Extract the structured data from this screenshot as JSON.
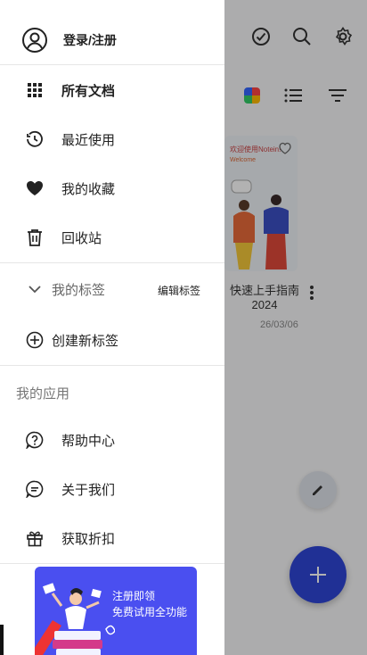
{
  "drawer": {
    "login": "登录/注册",
    "items": [
      {
        "label": "所有文档",
        "icon": "grid-icon"
      },
      {
        "label": "最近使用",
        "icon": "clock-icon"
      },
      {
        "label": "我的收藏",
        "icon": "heart-icon"
      },
      {
        "label": "回收站",
        "icon": "trash-icon"
      }
    ],
    "tags": {
      "title": "我的标签",
      "edit": "编辑标签",
      "create": "创建新标签"
    },
    "apps": {
      "title": "我的应用",
      "items": [
        {
          "label": "帮助中心",
          "icon": "help-icon"
        },
        {
          "label": "关于我们",
          "icon": "chat-icon"
        },
        {
          "label": "获取折扣",
          "icon": "gift-icon"
        }
      ]
    },
    "promo": {
      "line1": "注册即领",
      "line2": "免费试用全功能"
    }
  },
  "background": {
    "doc": {
      "title": "快速上手指南2024",
      "date": "26/03/06",
      "thumb_line1": "欢迎使用Notein!",
      "thumb_line2": "Welcome"
    },
    "toolbar_icons": [
      "check-circle-icon",
      "search-icon",
      "gear-icon"
    ],
    "filter_icons": [
      "color-palette-icon",
      "list-view-icon",
      "sort-icon"
    ]
  },
  "colors": {
    "accent": "#2f46d6",
    "promo_bg": "#4a4ff0",
    "scrim": "rgba(0,0,0,0.30)"
  }
}
